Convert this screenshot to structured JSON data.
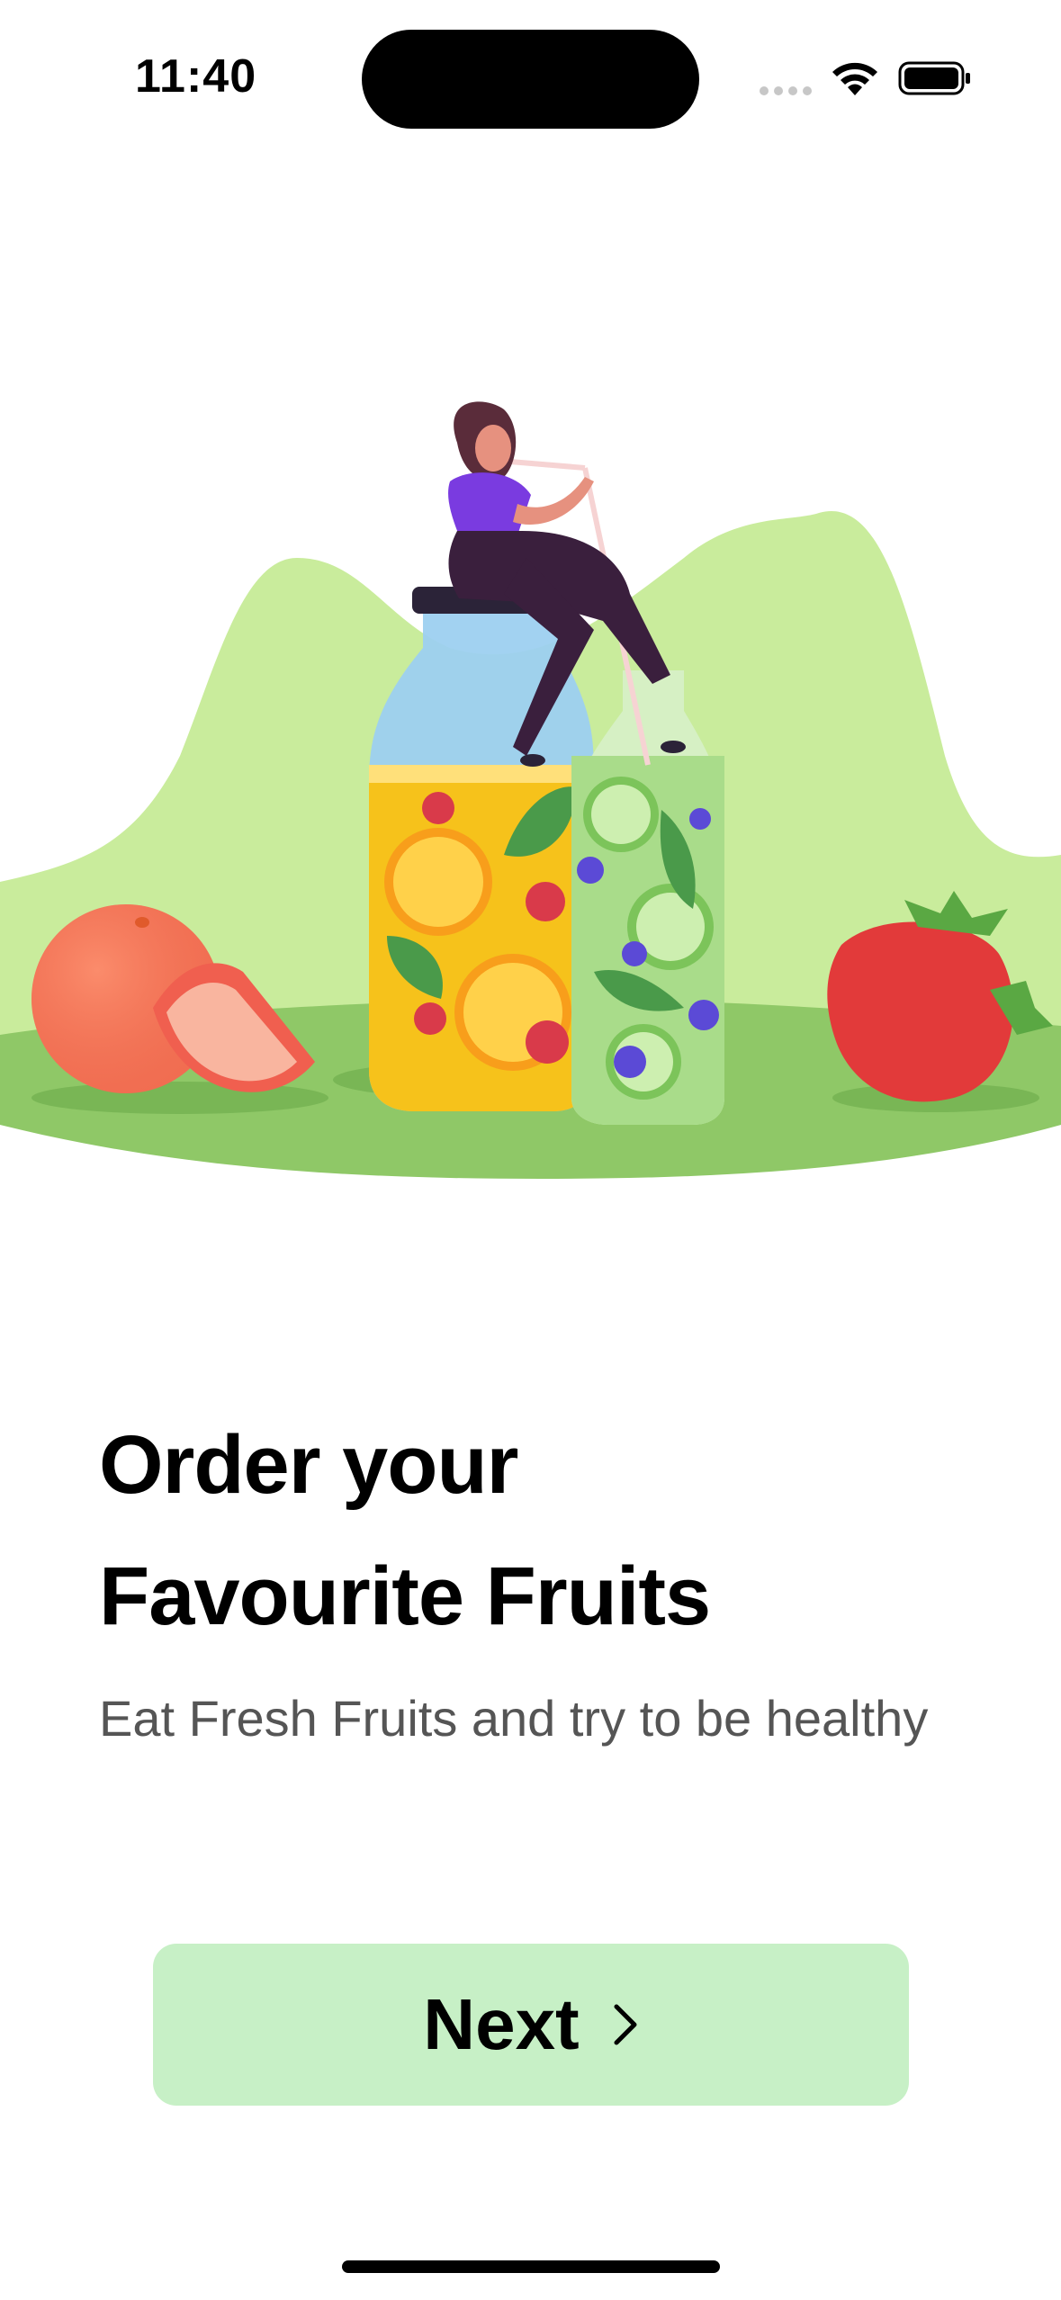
{
  "status_bar": {
    "time": "11:40",
    "icons": [
      "cellular-signal-icon",
      "wifi-icon",
      "battery-icon"
    ]
  },
  "hero": {
    "illustration": "woman-drinking-fruit-juice-illustration"
  },
  "content": {
    "title_line1": "Order your",
    "title_line2": "Favourite Fruits",
    "subtitle": "Eat Fresh Fruits and try to be healthy"
  },
  "button": {
    "label": "Next",
    "icon": "chevron-right-icon"
  },
  "colors": {
    "button_bg": "#c7f0c6",
    "subtitle": "#555555",
    "accent_green": "#8bc96a"
  }
}
